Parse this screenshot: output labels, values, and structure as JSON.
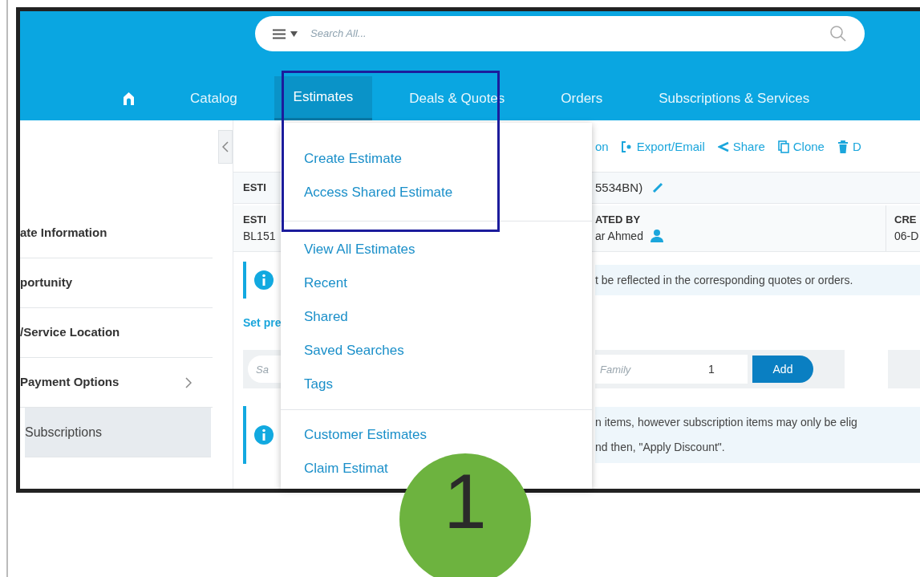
{
  "header": {
    "search": {
      "placeholder": "Search All..."
    }
  },
  "nav": [
    {
      "kind": "home",
      "selected": false
    },
    {
      "kind": "tab",
      "label": "Catalog",
      "selected": false
    },
    {
      "kind": "tab",
      "label": "Estimates",
      "selected": true
    },
    {
      "kind": "tab",
      "label": "Deals & Quotes",
      "selected": false
    },
    {
      "kind": "tab",
      "label": "Orders",
      "selected": false
    },
    {
      "kind": "tab",
      "label": "Subscriptions & Services",
      "selected": false
    }
  ],
  "sidebar": {
    "items": [
      {
        "label": "ate Information",
        "selected": false,
        "chevron": false
      },
      {
        "label": "portunity",
        "selected": false,
        "chevron": false
      },
      {
        "label": "/Service Location",
        "selected": false,
        "chevron": false
      },
      {
        "label": "Payment Options",
        "selected": false,
        "chevron": true
      },
      {
        "label": "Subscriptions",
        "selected": true,
        "chevron": false
      }
    ]
  },
  "toolbar": [
    {
      "kind": "text",
      "label": "on"
    },
    {
      "kind": "export",
      "label": "Export/Email"
    },
    {
      "kind": "share",
      "label": "Share"
    },
    {
      "kind": "clone",
      "label": "Clone"
    },
    {
      "kind": "delete",
      "label": "D"
    }
  ],
  "estimate_header": {
    "left": "ESTI",
    "right": "5534BN)"
  },
  "details": {
    "column_1": {
      "label": "ESTI",
      "value": "BL151"
    },
    "column_2": {
      "label": "ATED BY",
      "value": "ar Ahmed"
    },
    "column_3": {
      "label": "CRE",
      "value": "06-D"
    }
  },
  "notice_1": {
    "text": "t be reflected in the corresponding quotes or orders."
  },
  "set_link": "Set pre",
  "add_bar": {
    "search_placeholder": "Sa",
    "family_placeholder": "Family",
    "quantity": "1",
    "button": "Add"
  },
  "notice_2": {
    "lines": [
      "n items, however subscription items may only be elig",
      "nd then, \"Apply Discount\"."
    ]
  },
  "dropdown": {
    "groups": [
      [
        "Create Estimate",
        "Access Shared Estimate"
      ],
      [
        "View All Estimates",
        "Recent",
        "Shared",
        "Saved Searches",
        "Tags"
      ],
      [
        "Customer Estimates",
        "Claim Estimat"
      ]
    ]
  },
  "annotations": {
    "callout": "1"
  }
}
